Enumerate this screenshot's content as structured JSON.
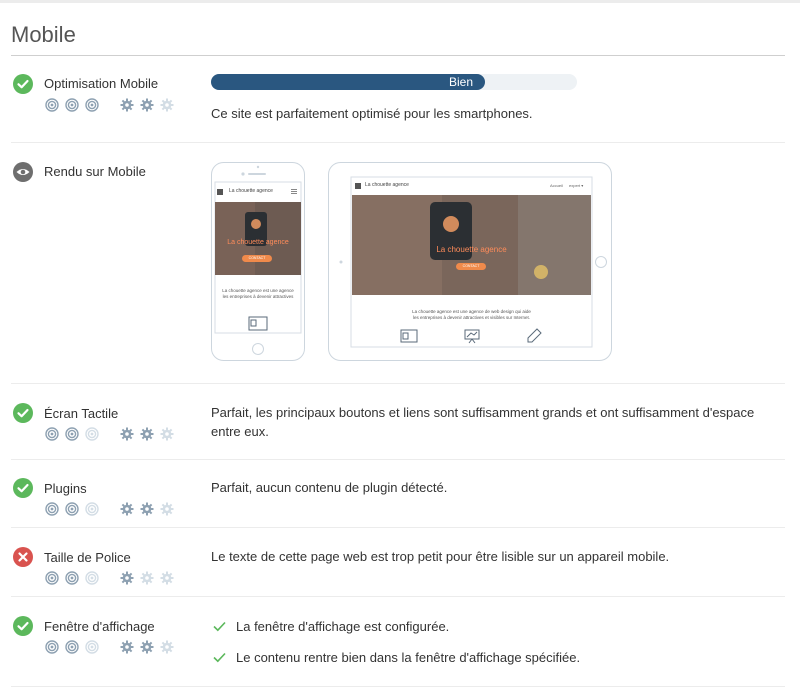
{
  "section": {
    "title": "Mobile"
  },
  "colors": {
    "ok": "#5cb85c",
    "neutral": "#6e6e6e",
    "error": "#d9534f",
    "bar": "#2a5780",
    "icon_on": "#8da0b1",
    "icon_off": "#d3dde5"
  },
  "rows": [
    {
      "label": "Optimisation Mobile",
      "status": "ok",
      "status_icon": "check-icon",
      "progress_label": "Bien",
      "progress_fraction": 0.75,
      "description": "Ce site est parfaitement optimisé pour les smartphones.",
      "targets_on": 3,
      "gears_on": 2
    },
    {
      "label": "Rendu sur Mobile",
      "status": "neutral",
      "status_icon": "eye-icon",
      "phone": {
        "brand": "La chouette agence",
        "hero": "La chouette agence",
        "cta": "CONTACT",
        "text1": "La chouette agence est une agence",
        "text2": "les entreprises à devenir attractives"
      },
      "tablet": {
        "brand": "La chouette agence",
        "nav1": "Accueil",
        "nav2": "expert ▾",
        "hero": "La chouette agence",
        "cta": "CONTACT",
        "text1": "La chouette agence est une agence de web design qui aide",
        "text2": "les entreprises à devenir attractives et visibles sur Internet."
      }
    },
    {
      "label": "Écran Tactile",
      "status": "ok",
      "status_icon": "check-icon",
      "description": "Parfait, les principaux boutons et liens sont suffisamment grands et ont suffisamment d'espace entre eux.",
      "targets_on": 2,
      "gears_on": 2
    },
    {
      "label": "Plugins",
      "status": "ok",
      "status_icon": "check-icon",
      "description": "Parfait, aucun contenu de plugin détecté.",
      "targets_on": 2,
      "gears_on": 2
    },
    {
      "label": "Taille de Police",
      "status": "error",
      "status_icon": "x-icon",
      "description": "Le texte de cette page web est trop petit pour être lisible sur un appareil mobile.",
      "targets_on": 2,
      "gears_on": 1
    },
    {
      "label": "Fenêtre d'affichage",
      "status": "ok",
      "status_icon": "check-icon",
      "checks": [
        "La fenêtre d'affichage est configurée.",
        "Le contenu rentre bien dans la fenêtre d'affichage spécifiée."
      ],
      "targets_on": 2,
      "gears_on": 2
    }
  ]
}
